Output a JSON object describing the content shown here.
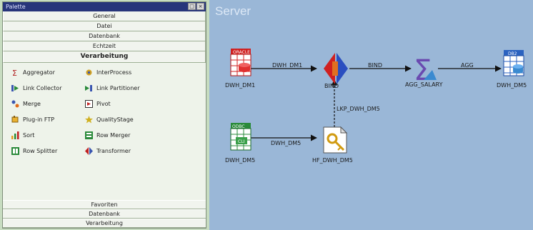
{
  "palette": {
    "title": "Palette",
    "top_categories": [
      "General",
      "Datei",
      "Datenbank",
      "Echtzeit"
    ],
    "active_category": "Verarbeitung",
    "items": [
      {
        "label": "Aggregator",
        "icon": "sigma-icon"
      },
      {
        "label": "InterProcess",
        "icon": "gear-icon"
      },
      {
        "label": "Link Collector",
        "icon": "link-collector-icon"
      },
      {
        "label": "Link Partitioner",
        "icon": "link-partitioner-icon"
      },
      {
        "label": "Merge",
        "icon": "merge-icon"
      },
      {
        "label": "Pivot",
        "icon": "pivot-icon"
      },
      {
        "label": "Plug-in FTP",
        "icon": "plugin-icon"
      },
      {
        "label": "QualityStage",
        "icon": "quality-icon"
      },
      {
        "label": "Sort",
        "icon": "sort-icon"
      },
      {
        "label": "Row Merger",
        "icon": "row-merger-icon"
      },
      {
        "label": "Row Splitter",
        "icon": "row-splitter-icon"
      },
      {
        "label": "Transformer",
        "icon": "transformer-icon"
      }
    ],
    "bottom_categories": [
      "Favoriten",
      "Datenbank",
      "Verarbeitung"
    ]
  },
  "canvas": {
    "title": "Server",
    "nodes": {
      "dwh_dm1_source": {
        "label": "DWH_DM1",
        "badge": "ORACLE",
        "icon": "oracle-db-icon"
      },
      "bind": {
        "label": "BIND",
        "icon": "transformer-icon"
      },
      "agg_salary": {
        "label": "AGG_SALARY",
        "icon": "aggregator-sigma-icon"
      },
      "dwh_dm5_target": {
        "label": "DWH_DM5",
        "badge": "DB2",
        "icon": "db2-target-icon"
      },
      "dwh_dm5_source": {
        "label": "DWH_DM5",
        "badge": "ODBC",
        "icon": "odbc-db-icon"
      },
      "hf_dwh_dm5": {
        "label": "HF_DWH_DM5",
        "icon": "hashed-file-icon"
      }
    },
    "links": {
      "dwh_dm1": "DWH_DM1",
      "bind": "BIND",
      "agg": "AGG",
      "dwh_dm5": "DWH_DM5",
      "lkp_dwh_dm5": "LKP_DWH_DM5"
    }
  },
  "colors": {
    "palette_title_bar": "#27357a",
    "canvas_background": "#9ab7d7",
    "window_background": "#c7dcc0"
  }
}
